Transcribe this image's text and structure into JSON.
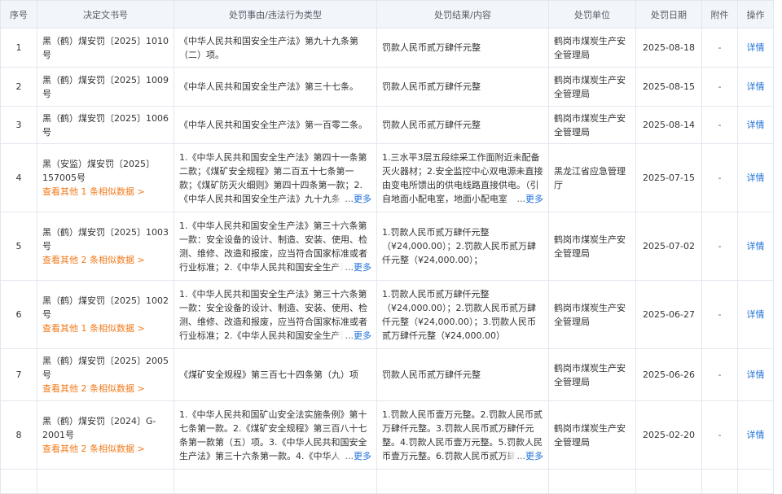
{
  "headers": {
    "index": "序号",
    "doc_no": "决定文书号",
    "reason": "处罚事由/违法行为类型",
    "result": "处罚结果/内容",
    "unit": "处罚单位",
    "date": "处罚日期",
    "attachment": "附件",
    "action": "操作"
  },
  "common": {
    "detail_label": "详情",
    "more_label": "更多",
    "ellipsis": "...",
    "attachment_empty": "-"
  },
  "rows": [
    {
      "index": "1",
      "doc_no": "黑（鹤）煤安罚〔2025〕1010号",
      "similar": "",
      "reason": "《中华人民共和国安全生产法》第九十九条第（二）项。",
      "reason_more": false,
      "result": "罚款人民币贰万肆仟元整",
      "result_more": false,
      "unit": "鹤岗市煤炭生产安全管理局",
      "date": "2025-08-18"
    },
    {
      "index": "2",
      "doc_no": "黑（鹤）煤安罚〔2025〕1009号",
      "similar": "",
      "reason": "《中华人民共和国安全生产法》第三十七条。",
      "reason_more": false,
      "result": "罚款人民币贰万肆仟元整",
      "result_more": false,
      "unit": "鹤岗市煤炭生产安全管理局",
      "date": "2025-08-15"
    },
    {
      "index": "3",
      "doc_no": "黑（鹤）煤安罚〔2025〕1006号",
      "similar": "",
      "reason": "《中华人民共和国安全生产法》第一百零二条。",
      "reason_more": false,
      "result": "罚款人民币贰万肆仟元整",
      "result_more": false,
      "unit": "鹤岗市煤炭生产安全管理局",
      "date": "2025-08-14"
    },
    {
      "index": "4",
      "doc_no": "黑（安监）煤安罚〔2025〕157005号",
      "similar": "查看其他 1 条相似数据 >",
      "reason": "1.《中华人民共和国安全生产法》第四十一条第二款；《煤矿安全规程》第二百五十七条第一款；《煤矿防灭火细则》第四十四条第一款；2.《中华人民共和国安全生产法》九十九条",
      "reason_more": true,
      "result": "1.三水平3层五段综采工作面附近未配备灭火器材；2.安全监控中心双电源未直接由变电所馈出的供电线路直接供电。（引自地面小配电室，地面小配电室",
      "result_more": true,
      "unit": "黑龙江省应急管理厅",
      "date": "2025-07-15"
    },
    {
      "index": "5",
      "doc_no": "黑（鹤）煤安罚〔2025〕1003号",
      "similar": "查看其他 2 条相似数据 >",
      "reason": "1.《中华人民共和国安全生产法》第三十六条第一款：安全设备的设计、制造、安装、使用、检测、维修、改造和报废，应当符合国家标准或者行业标准；2.《中华人民共和国安全生产法》",
      "reason_more": true,
      "result": "1.罚款人民币贰万肆仟元整（¥24,000.00）；2.罚款人民币贰万肆仟元整（¥24,000.00）；",
      "result_more": false,
      "unit": "鹤岗市煤炭生产安全管理局",
      "date": "2025-07-02"
    },
    {
      "index": "6",
      "doc_no": "黑（鹤）煤安罚〔2025〕1002号",
      "similar": "查看其他 1 条相似数据 >",
      "reason": "1.《中华人民共和国安全生产法》第三十六条第一款：安全设备的设计、制造、安装、使用、检测、维修、改造和报废，应当符合国家标准或者行业标准；2.《中华人民共和国安全生产法》",
      "reason_more": true,
      "result": "1.罚款人民币贰万肆仟元整（¥24,000.00）；2.罚款人民币贰万肆仟元整（¥24,000.00）；3.罚款人民币贰万肆仟元整（¥24,000.00）",
      "result_more": false,
      "unit": "鹤岗市煤炭生产安全管理局",
      "date": "2025-06-27"
    },
    {
      "index": "7",
      "doc_no": "黑（鹤）煤安罚〔2025〕2005号",
      "similar": "查看其他 2 条相似数据 >",
      "reason": "《煤矿安全规程》第三百七十四条第（九）项",
      "reason_more": false,
      "result": "罚款人民币贰万肆仟元整",
      "result_more": false,
      "unit": "鹤岗市煤炭生产安全管理局",
      "date": "2025-06-26"
    },
    {
      "index": "8",
      "doc_no": "黑（鹤）煤安罚〔2024〕G-2001号",
      "similar": "查看其他 2 条相似数据 >",
      "reason": "1.《中华人民共和国矿山安全法实施条例》第十七条第一款。2.《煤矿安全规程》第三百八十七条第一款第（五）项。3.《中华人民共和国安全生产法》第三十六条第一款。4.《中华人",
      "reason_more": true,
      "result": "1.罚款人民币壹万元整。2.罚款人民币贰万肆仟元整。3.罚款人民币贰万肆仟元整。4.罚款人民币壹万元整。5.罚款人民币壹万元整。6.罚款人民币贰万肆",
      "result_more": true,
      "unit": "鹤岗市煤炭生产安全管理局",
      "date": "2025-02-20"
    },
    {
      "index": "",
      "doc_no": "",
      "similar": "",
      "reason": "",
      "reason_more": false,
      "result": "",
      "result_more": false,
      "unit": "",
      "date": ""
    }
  ]
}
